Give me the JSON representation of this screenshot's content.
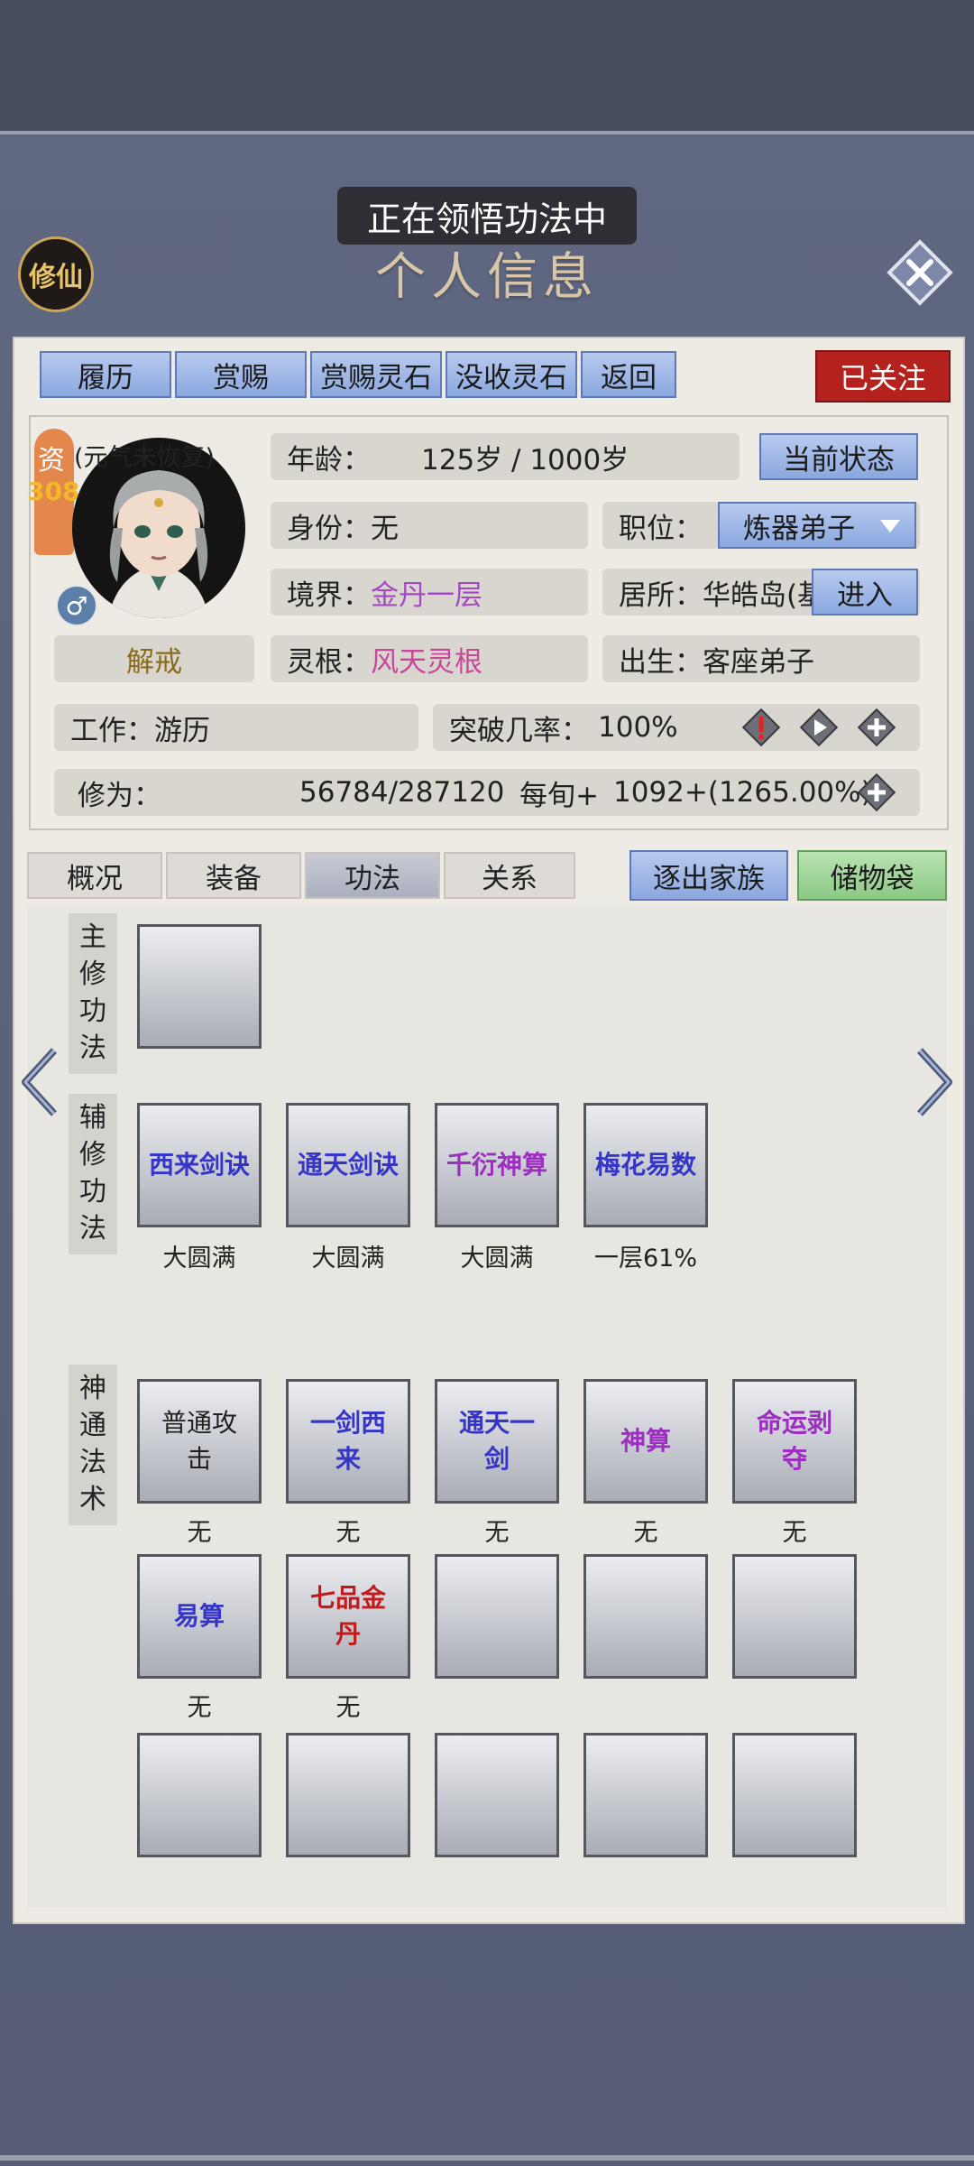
{
  "header": {
    "toast": "正在领悟功法中",
    "title": "个人信息",
    "logo_text": "修仙"
  },
  "toolbar": {
    "buttons": [
      "履历",
      "赏赐",
      "赏赐灵石",
      "没收灵石",
      "返回"
    ],
    "follow_label": "已关注"
  },
  "character": {
    "aptitude_label": "资",
    "aptitude_value": "308",
    "mood": "(元气未恢复)",
    "gender_symbol": "♂",
    "status_tag": "解戒",
    "age_label": "年龄：",
    "age_value": "125岁 / 1000岁",
    "current_state_button": "当前状态",
    "identity_label": "身份：",
    "identity_value": "无",
    "position_label": "职位：",
    "position_value": "炼器弟子",
    "realm_label": "境界：",
    "realm_value": "金丹一层",
    "residence_label": "居所：",
    "residence_value": "华皓岛(基",
    "enter_button": "进入",
    "root_label": "灵根：",
    "root_value": "风天灵根",
    "birth_label": "出生：",
    "birth_value": "客座弟子",
    "job_label": "工作：",
    "job_value": "游历",
    "breakthrough_label": "突破几率：",
    "breakthrough_value": "100%",
    "cultivation_label": "修为：",
    "cultivation_value": "56784/287120",
    "per_period_label": "每旬+",
    "per_period_value": "1092+(1265.00%)"
  },
  "tabs": {
    "items": [
      "概况",
      "装备",
      "功法",
      "关系"
    ],
    "active": "功法"
  },
  "actions": {
    "expel": "逐出家族",
    "storage": "储物袋"
  },
  "sections": {
    "main": "主修功法",
    "aux": "辅修功法",
    "skills": "神通法术"
  },
  "aux_techniques": [
    {
      "name": "西来剑诀",
      "level": "大圆满"
    },
    {
      "name": "通天剑诀",
      "level": "大圆满"
    },
    {
      "name": "千衍神算",
      "level": "大圆满"
    },
    {
      "name": "梅花易数",
      "level": "一层61%"
    }
  ],
  "skills_row1": [
    {
      "name": "普通攻击",
      "level": "无"
    },
    {
      "name": "一剑西来",
      "level": "无"
    },
    {
      "name": "通天一剑",
      "level": "无"
    },
    {
      "name": "神算",
      "level": "无"
    },
    {
      "name": "命运剥夺",
      "level": "无"
    }
  ],
  "skills_row2": [
    {
      "name": "易算",
      "level": "无"
    },
    {
      "name": "七品金丹",
      "level": "无"
    }
  ],
  "colors": {
    "accent_purple": "#a548c4",
    "accent_pink": "#c8479b",
    "follow_red": "#b5221d",
    "button_blue": "#8aa7df",
    "button_green": "#8cc986"
  }
}
